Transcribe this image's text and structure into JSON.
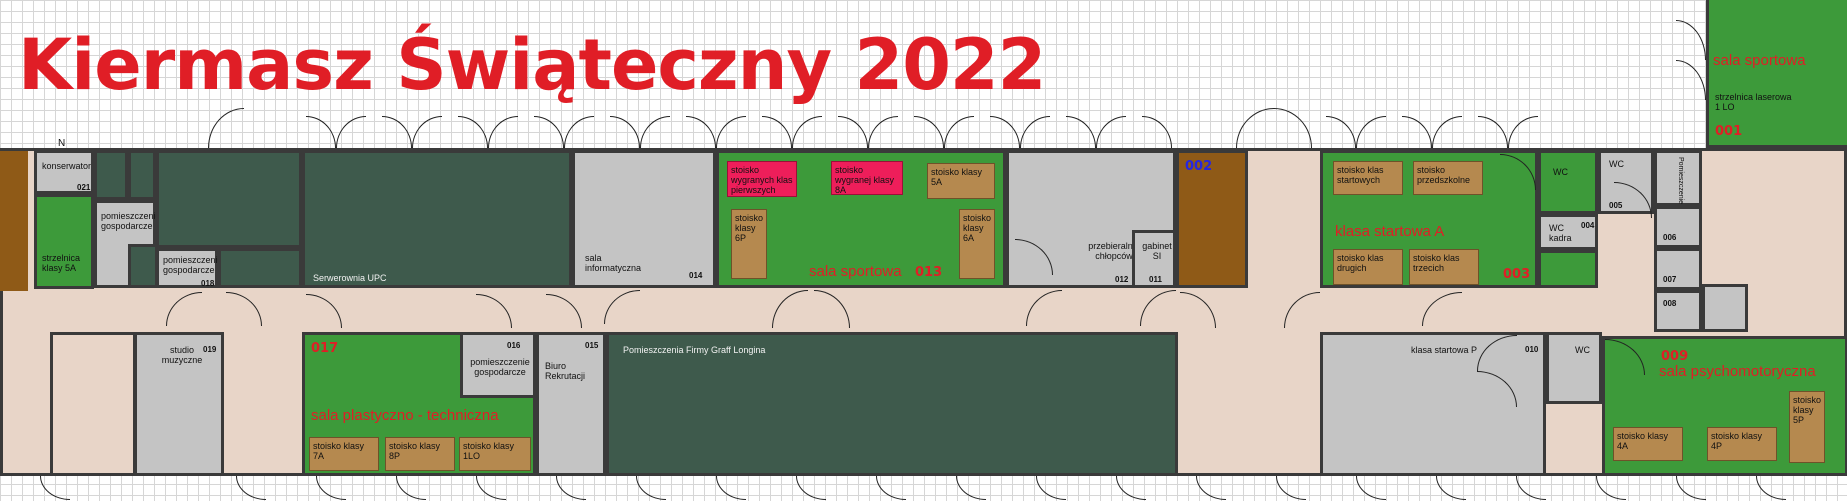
{
  "title": "Kiermasz Świąteczny 2022",
  "compass": "N",
  "rooms": {
    "konserwator": {
      "label": "konserwator",
      "num": "021"
    },
    "pom_gosp_top": {
      "label": "pomieszczenie gospodarcze"
    },
    "strzelnica_5a": {
      "label": "strzelnica klasy 5A",
      "num": "020"
    },
    "pom_gosp_018": {
      "label": "pomieszczenie gospodarcze",
      "num": "018"
    },
    "serwerownia": {
      "label": "Serwerownia UPC"
    },
    "sala_inf": {
      "label": "sala informatyczna",
      "num": "014"
    },
    "sala_sportowa_013": {
      "label": "sala sportowa",
      "num": "013"
    },
    "przebieralnia": {
      "label": "przebieralnia chłopców",
      "num": "012"
    },
    "gabinet_si": {
      "label": "gabinet SI",
      "num": "011"
    },
    "room_002": {
      "num": "002"
    },
    "klasa_startowa_a": {
      "label": "klasa startowa A",
      "num": "003"
    },
    "wc_1": {
      "label": "WC"
    },
    "wc_2": {
      "label": "WC",
      "num": "005"
    },
    "wc_kadra": {
      "label": "WC kadra",
      "num": "004"
    },
    "pom_gosp_right": {
      "label": "Pomieszczenie gospodarcze"
    },
    "small_006": {
      "num": "006"
    },
    "small_007": {
      "num": "007"
    },
    "small_008": {
      "num": "008"
    },
    "sala_sportowa_001": {
      "label": "sala sportowa",
      "sub": "strzelnica laserowa 1 LO",
      "num": "001"
    },
    "studio": {
      "label": "studio muzyczne",
      "num": "019"
    },
    "sala_plastyczna": {
      "label": "sala plastyczno - techniczna",
      "num": "017"
    },
    "pom_gosp_016": {
      "label": "pomieszczenie gospodarcze",
      "num": "016"
    },
    "biuro": {
      "label": "Biuro Rekrutacji",
      "num": "015"
    },
    "graff": {
      "label": "Pomieszczenia Firmy Graff Longina"
    },
    "klasa_startowa_p": {
      "label": "klasa startowa P",
      "num": "010"
    },
    "wc_3": {
      "label": "WC"
    },
    "sala_psycho": {
      "label": "sala psychomotoryczna",
      "num": "009"
    }
  },
  "stands": {
    "wygranych_klas_pierwszych": "stoisko wygranych klas pierwszych",
    "wygranej_klasy_8a": "stoisko wygranej klasy 8A",
    "klasy_5a": "stoisko klasy 5A",
    "klasy_6p": "stoisko klasy 6P",
    "klasy_6a": "stoisko klasy 6A",
    "klas_startowych": "stoisko klas startowych",
    "przedszkolne": "stoisko przedszkolne",
    "klas_drugich": "stoisko klas drugich",
    "klas_trzecich": "stoisko klas trzecich",
    "klasy_7a": "stoisko klasy 7A",
    "klasy_8p": "stoisko klasy 8P",
    "klasy_1lo": "stoisko klasy 1LO",
    "klasy_4a": "stoisko klasy 4A",
    "klasy_4p": "stoisko klasy 4P",
    "klasy_5p": "stoisko klasy 5P"
  },
  "colors": {
    "title_red": "#e01e26",
    "room_green": "#3d9a3a",
    "room_dark": "#3e5a4c",
    "room_grey": "#c4c4c4",
    "corridor": "#e8d5c8",
    "stand": "#b5894f",
    "stand_highlight": "#ee1e5a",
    "brown_room": "#8f5a17"
  }
}
